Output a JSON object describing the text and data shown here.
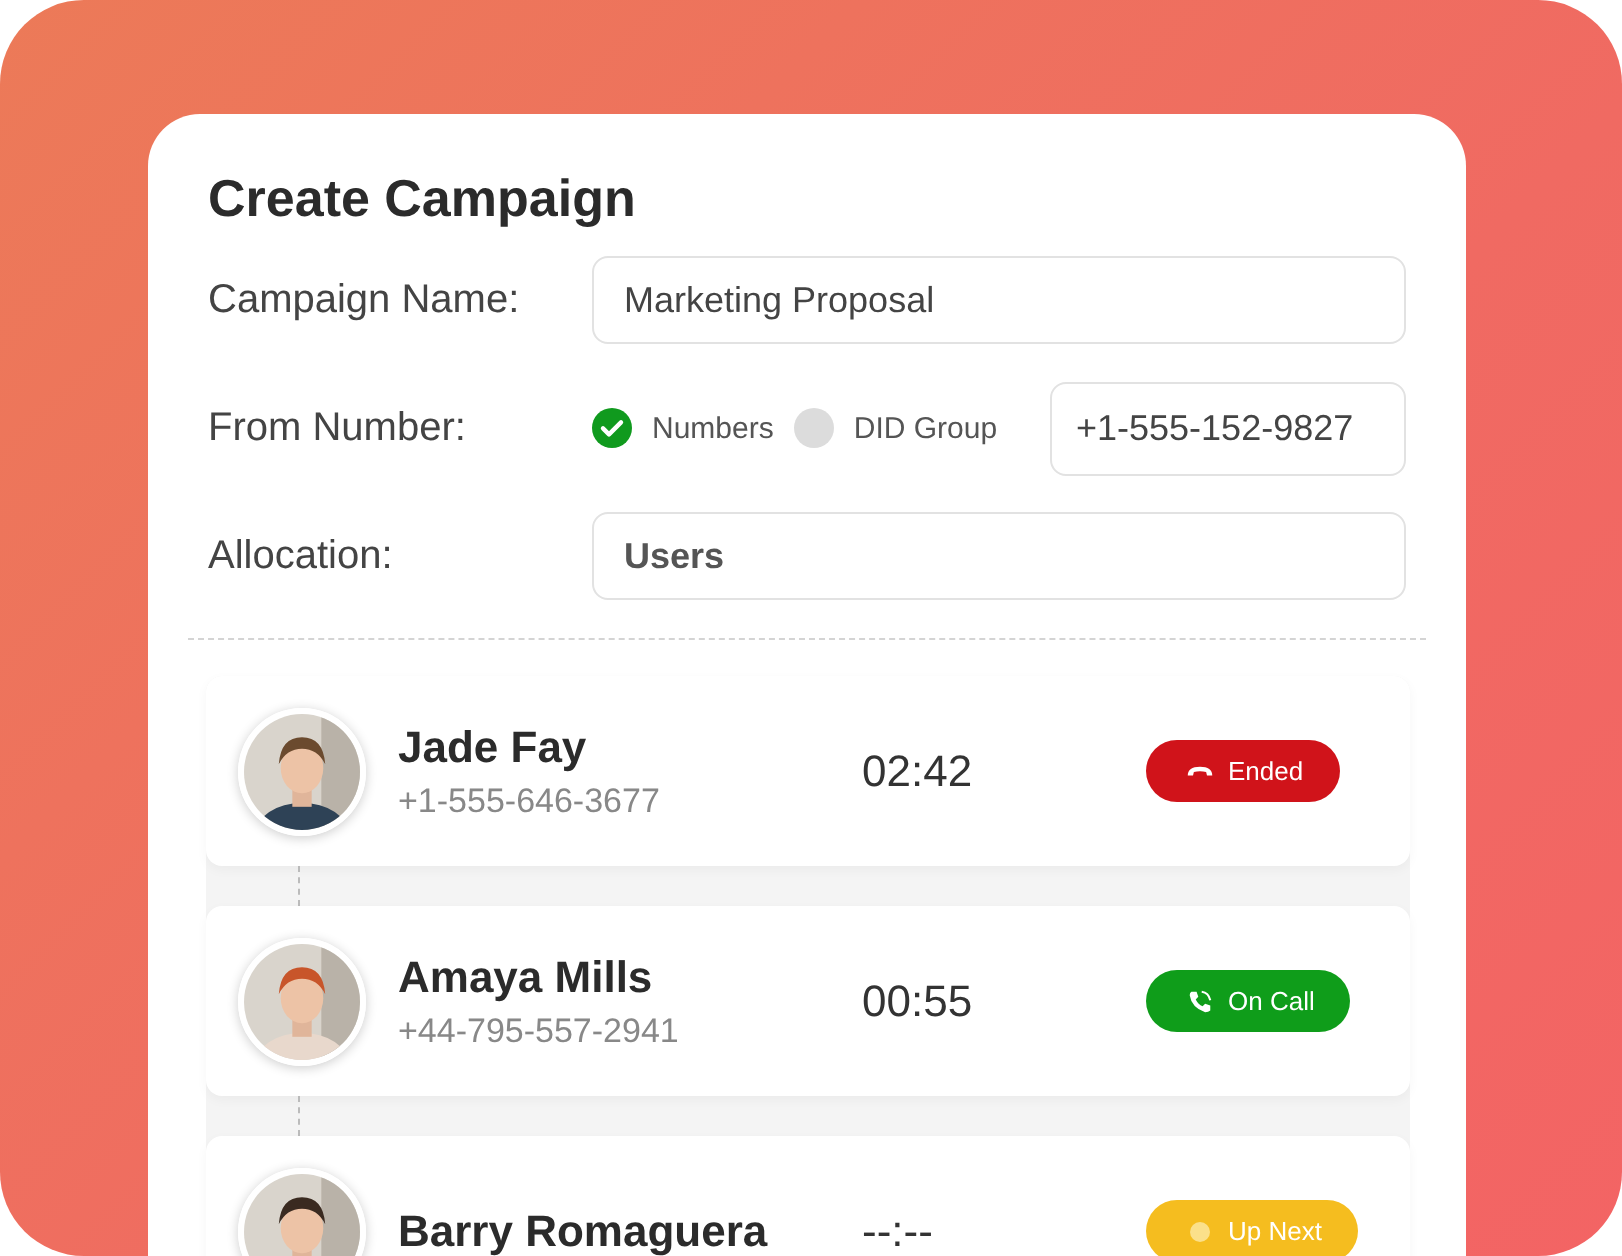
{
  "form": {
    "title": "Create Campaign",
    "campaign_name": {
      "label": "Campaign Name:",
      "value": "Marketing Proposal"
    },
    "from_number": {
      "label": "From Number:",
      "options": [
        {
          "label": "Numbers",
          "selected": true
        },
        {
          "label": "DID Group",
          "selected": false
        }
      ],
      "value": "+1-555-152-9827"
    },
    "allocation": {
      "label": "Allocation:",
      "value": "Users"
    }
  },
  "calls": [
    {
      "name": "Jade Fay",
      "phone": "+1-555-646-3677",
      "time": "02:42",
      "status": {
        "kind": "ended",
        "label": "Ended",
        "color": "#d0131a"
      }
    },
    {
      "name": "Amaya Mills",
      "phone": "+44-795-557-2941",
      "time": "00:55",
      "status": {
        "kind": "on_call",
        "label": "On Call",
        "color": "#0f9d1a"
      }
    },
    {
      "name": "Barry Romaguera",
      "time": "--:--",
      "status": {
        "kind": "up_next",
        "label": "Up Next",
        "color": "#f5bd1f"
      }
    }
  ]
}
